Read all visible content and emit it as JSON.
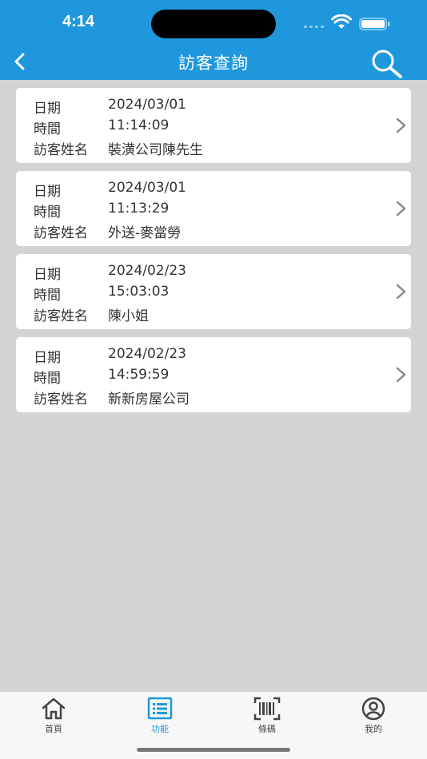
{
  "status_bar": {
    "time": "4:14"
  },
  "nav": {
    "title": "訪客查詢",
    "back_icon": "chevron-left-icon",
    "search_icon": "search-icon"
  },
  "labels": {
    "date": "日期",
    "time": "時間",
    "visitor": "訪客姓名"
  },
  "visits": [
    {
      "date": "2024/03/01",
      "time": "11:14:09",
      "visitor": "裝潢公司陳先生"
    },
    {
      "date": "2024/03/01",
      "time": "11:13:29",
      "visitor": "外送-麥當勞"
    },
    {
      "date": "2024/02/23",
      "time": "15:03:03",
      "visitor": "陳小姐"
    },
    {
      "date": "2024/02/23",
      "time": "14:59:59",
      "visitor": "新新房屋公司"
    }
  ],
  "tabs": [
    {
      "label": "首頁",
      "icon": "home-icon"
    },
    {
      "label": "功能",
      "icon": "list-icon",
      "active": true
    },
    {
      "label": "條碼",
      "icon": "barcode-icon"
    },
    {
      "label": "我的",
      "icon": "profile-icon"
    }
  ],
  "colors": {
    "primary": "#1e97dc",
    "background": "#d3d3d3"
  }
}
